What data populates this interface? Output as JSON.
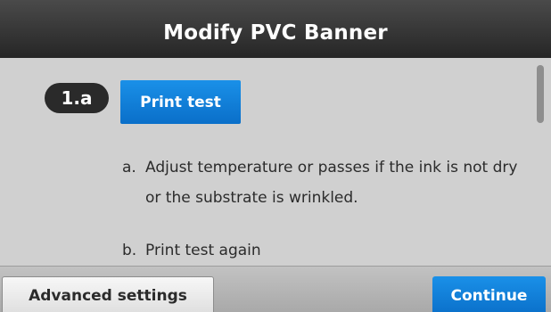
{
  "header": {
    "title": "Modify PVC Banner"
  },
  "step": {
    "badge": "1.a",
    "print_test_label": "Print test"
  },
  "instructions": [
    {
      "marker": "a.",
      "text": "Adjust temperature or passes if the ink is not dry or the substrate is wrinkled."
    },
    {
      "marker": "b.",
      "text": "Print test again"
    }
  ],
  "footer": {
    "advanced_label": "Advanced settings",
    "continue_label": "Continue"
  },
  "colors": {
    "title_bar": "#2e2e2e",
    "content_bg": "#d0d0d0",
    "accent_blue": "#0f7fd8",
    "badge_bg": "#2a2a2a"
  }
}
